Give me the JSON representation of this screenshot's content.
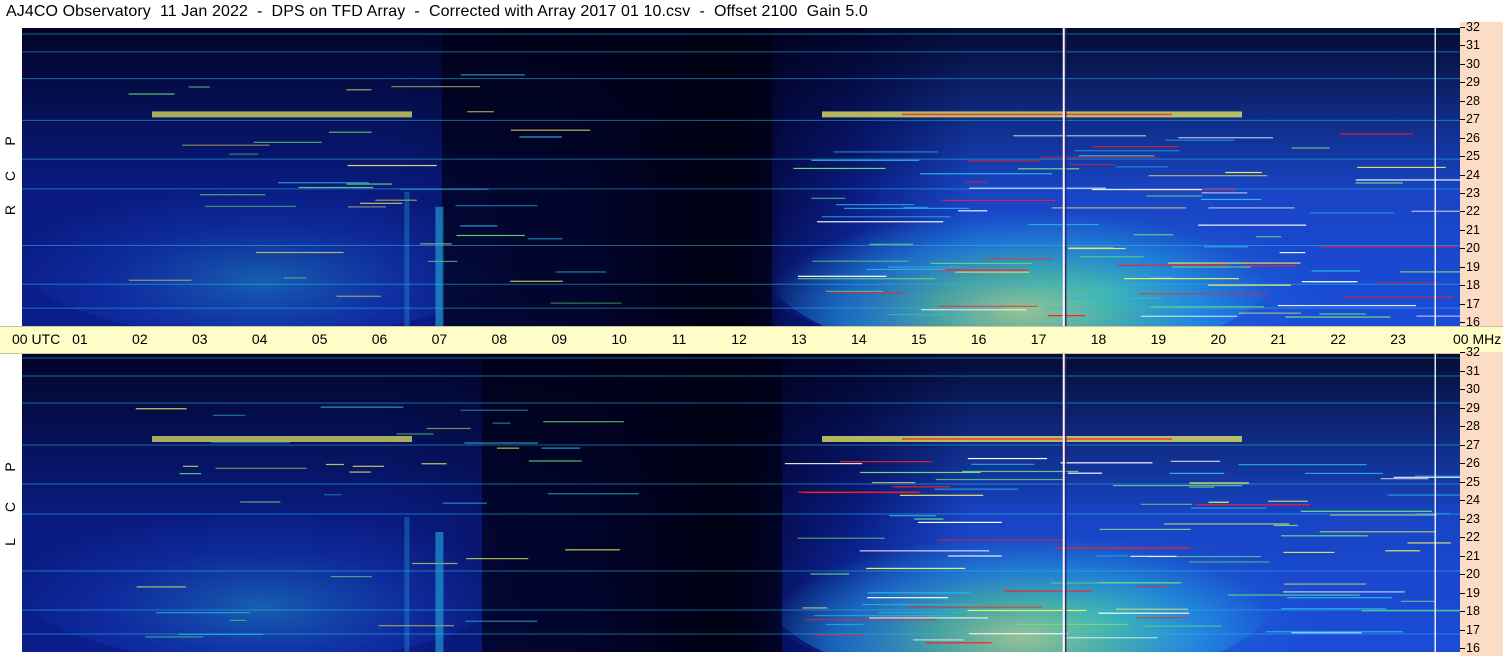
{
  "window": {
    "title": "AJ4CO Observatory  11 Jan 2022  -  DPS on TFD Array  -  Corrected with Array 2017 01 10.csv  -  Offset 2100  Gain 5.0"
  },
  "panels": {
    "rcp": {
      "letters": [
        "P",
        "C",
        "R"
      ]
    },
    "lcp": {
      "letters": [
        "P",
        "C",
        "L"
      ]
    }
  },
  "time_axis": {
    "labels": [
      "00  UTC",
      "01",
      "02",
      "03",
      "04",
      "05",
      "06",
      "07",
      "08",
      "09",
      "10",
      "11",
      "12",
      "13",
      "14",
      "15",
      "16",
      "17",
      "18",
      "19",
      "20",
      "21",
      "22",
      "23",
      "00 MHz"
    ]
  },
  "freq_axis": {
    "unit": "MHz",
    "labels": [
      "32",
      "31",
      "30",
      "29",
      "28",
      "27",
      "26",
      "25",
      "24",
      "23",
      "22",
      "21",
      "20",
      "19",
      "18",
      "17",
      "16"
    ]
  },
  "colors": {
    "background_dark": "#000016",
    "deep_blue": "#0a1e8c",
    "blue": "#1b4cd8",
    "cyan": "#27b8e8",
    "green": "#6be07a",
    "yellow": "#f0f060",
    "red": "#ff2020",
    "white": "#ffffff",
    "timebar": "#fffdc7",
    "freq_axis_bg": "#fcdcc4"
  },
  "icons": {
    "rfi_marker": "vertical-line"
  }
}
